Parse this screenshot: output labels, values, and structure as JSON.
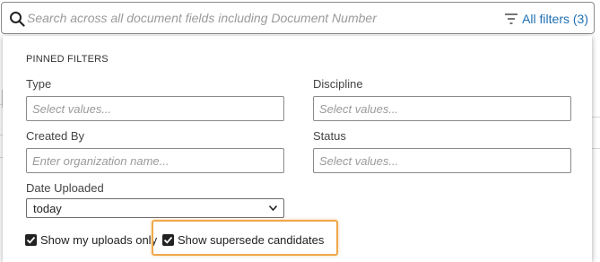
{
  "search": {
    "placeholder": "Search across all document fields including Document Number",
    "all_filters_label": "All filters (3)"
  },
  "panel": {
    "section_title": "PINNED FILTERS",
    "fields": {
      "type": {
        "label": "Type",
        "placeholder": "Select values..."
      },
      "discipline": {
        "label": "Discipline",
        "placeholder": "Select values..."
      },
      "created_by": {
        "label": "Created By",
        "placeholder": "Enter organization name..."
      },
      "status": {
        "label": "Status",
        "placeholder": "Select values..."
      },
      "date_uploaded": {
        "label": "Date Uploaded",
        "value": "today"
      }
    },
    "checkboxes": {
      "show_my_uploads": {
        "label": "Show my uploads only",
        "checked": true
      },
      "show_supersede": {
        "label": "Show supersede candidates",
        "checked": true
      }
    }
  },
  "colors": {
    "link": "#1f6fb2",
    "highlight": "#f0a84a"
  }
}
